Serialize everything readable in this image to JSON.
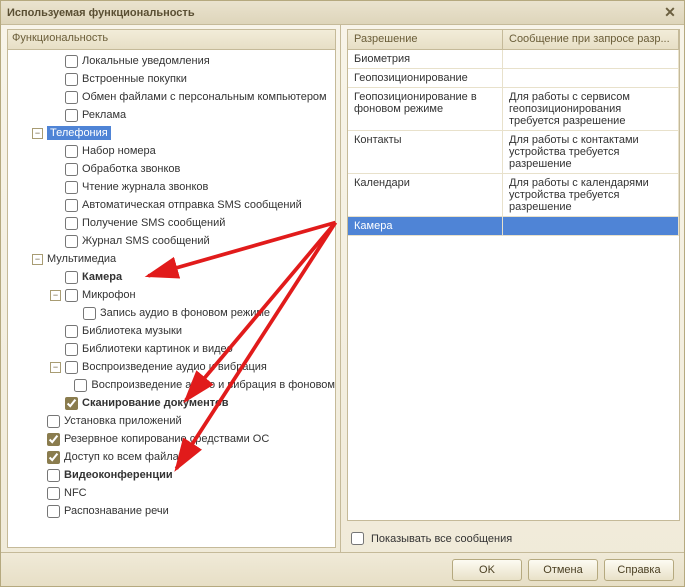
{
  "title": "Используемая функциональность",
  "left_header": "Функциональность",
  "tree": [
    {
      "depth": 1,
      "exp": null,
      "chk": false,
      "label": "Локальные уведомления"
    },
    {
      "depth": 1,
      "exp": null,
      "chk": false,
      "label": "Встроенные покупки"
    },
    {
      "depth": 1,
      "exp": null,
      "chk": false,
      "label": "Обмен файлами с персональным компьютером"
    },
    {
      "depth": 1,
      "exp": null,
      "chk": false,
      "label": "Реклама"
    },
    {
      "depth": 0,
      "exp": "-",
      "chk": null,
      "label": "Телефония",
      "selected": true
    },
    {
      "depth": 1,
      "exp": null,
      "chk": false,
      "label": "Набор номера"
    },
    {
      "depth": 1,
      "exp": null,
      "chk": false,
      "label": "Обработка звонков"
    },
    {
      "depth": 1,
      "exp": null,
      "chk": false,
      "label": "Чтение журнала звонков"
    },
    {
      "depth": 1,
      "exp": null,
      "chk": false,
      "label": "Автоматическая отправка SMS сообщений"
    },
    {
      "depth": 1,
      "exp": null,
      "chk": false,
      "label": "Получение SMS сообщений"
    },
    {
      "depth": 1,
      "exp": null,
      "chk": false,
      "label": "Журнал SMS сообщений"
    },
    {
      "depth": 0,
      "exp": "-",
      "chk": null,
      "label": "Мультимедиа"
    },
    {
      "depth": 1,
      "exp": null,
      "chk": false,
      "label": "Камера",
      "bold": true
    },
    {
      "depth": 1,
      "exp": "-",
      "chk": false,
      "label": "Микрофон"
    },
    {
      "depth": 2,
      "exp": null,
      "chk": false,
      "label": "Запись аудио в фоновом режиме"
    },
    {
      "depth": 1,
      "exp": null,
      "chk": false,
      "label": "Библиотека музыки"
    },
    {
      "depth": 1,
      "exp": null,
      "chk": false,
      "label": "Библиотеки картинок и видео"
    },
    {
      "depth": 1,
      "exp": "-",
      "chk": false,
      "label": "Воспроизведение аудио и вибрация"
    },
    {
      "depth": 2,
      "exp": null,
      "chk": false,
      "label": "Воспроизведение аудио и вибрация в фоновом"
    },
    {
      "depth": 1,
      "exp": null,
      "chk": true,
      "label": "Сканирование документов",
      "bold": true
    },
    {
      "depth": 0,
      "exp": null,
      "chk": false,
      "label": "Установка приложений"
    },
    {
      "depth": 0,
      "exp": null,
      "chk": true,
      "label": "Резервное копирование средствами ОС"
    },
    {
      "depth": 0,
      "exp": null,
      "chk": true,
      "label": "Доступ ко всем файлам"
    },
    {
      "depth": 0,
      "exp": null,
      "chk": false,
      "label": "Видеоконференции",
      "bold": true
    },
    {
      "depth": 0,
      "exp": null,
      "chk": false,
      "label": "NFC"
    },
    {
      "depth": 0,
      "exp": null,
      "chk": false,
      "label": "Распознавание речи"
    }
  ],
  "right_header": "Разрешение",
  "table": {
    "columns": [
      "Разрешение",
      "Сообщение при запросе разр..."
    ],
    "rows": [
      {
        "perm": "Биометрия",
        "msg": ""
      },
      {
        "perm": "Геопозиционирование",
        "msg": ""
      },
      {
        "perm": "Геопозиционирование в фоновом режиме",
        "msg": "Для работы с сервисом геопозиционирования требуется разрешение"
      },
      {
        "perm": "Контакты",
        "msg": "Для работы с контактами устройства требуется разрешение"
      },
      {
        "perm": "Календари",
        "msg": "Для работы с календарями устройства требуется разрешение"
      },
      {
        "perm": "Камера",
        "msg": "",
        "selected": true
      }
    ]
  },
  "show_all_label": "Показывать все сообщения",
  "buttons": {
    "ok": "OK",
    "cancel": "Отмена",
    "help": "Справка"
  },
  "colors": {
    "selection": "#4f84d6",
    "arrow": "#e11b1b"
  }
}
